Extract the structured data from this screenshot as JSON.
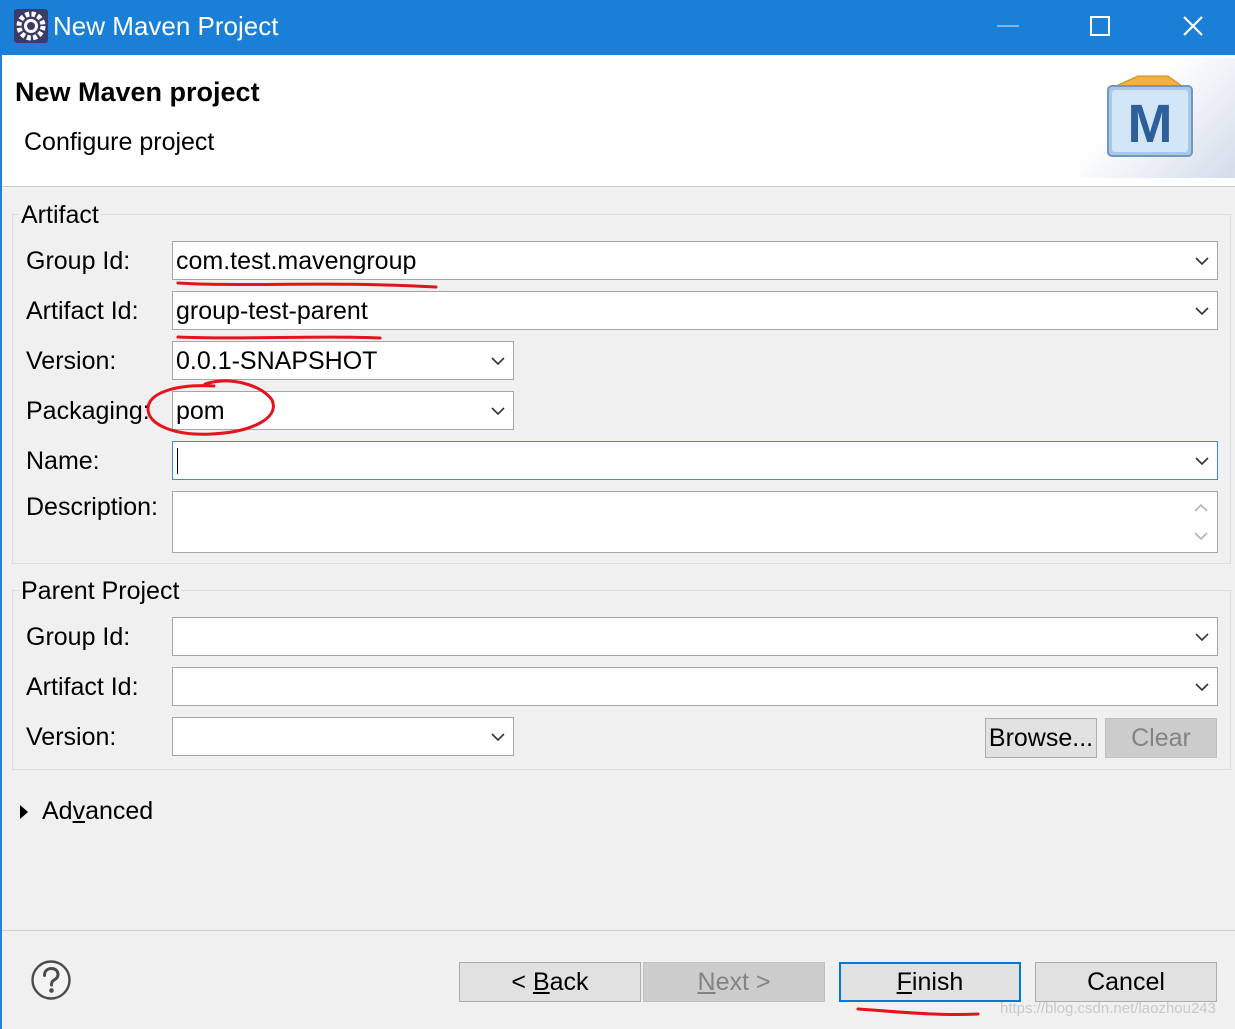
{
  "window": {
    "title": "New Maven Project",
    "icons": {
      "app": "eclipse-gear-icon",
      "minimize": "minimize-icon",
      "maximize": "maximize-icon",
      "close": "close-icon"
    }
  },
  "header": {
    "title": "New Maven project",
    "subtitle": "Configure project",
    "logo_letter": "M"
  },
  "artifact": {
    "group_title": "Artifact",
    "group_id_label": "Group Id:",
    "group_id_value": "com.test.mavengroup",
    "artifact_id_label": "Artifact Id:",
    "artifact_id_value": "group-test-parent",
    "version_label": "Version:",
    "version_value": "0.0.1-SNAPSHOT",
    "packaging_label": "Packaging:",
    "packaging_value": "pom",
    "name_label": "Name:",
    "name_value": "",
    "description_label": "Description:",
    "description_value": ""
  },
  "parent": {
    "group_title": "Parent Project",
    "group_id_label": "Group Id:",
    "group_id_value": "",
    "artifact_id_label": "Artifact Id:",
    "artifact_id_value": "",
    "version_label": "Version:",
    "version_value": "",
    "browse_label": "Browse...",
    "clear_label": "Clear"
  },
  "advanced": {
    "label_pre": "Ad",
    "label_mnemonic": "v",
    "label_post": "anced"
  },
  "footer": {
    "back_pre": "< ",
    "back_mnemonic": "B",
    "back_post": "ack",
    "next_mnemonic": "N",
    "next_post": "ext >",
    "finish_mnemonic": "F",
    "finish_post": "inish",
    "cancel_label": "Cancel",
    "watermark": "https://blog.csdn.net/laozhou243"
  },
  "colors": {
    "titlebar": "#1a7fd6",
    "focus": "#3c8bd6",
    "annotation": "#e3141b"
  }
}
